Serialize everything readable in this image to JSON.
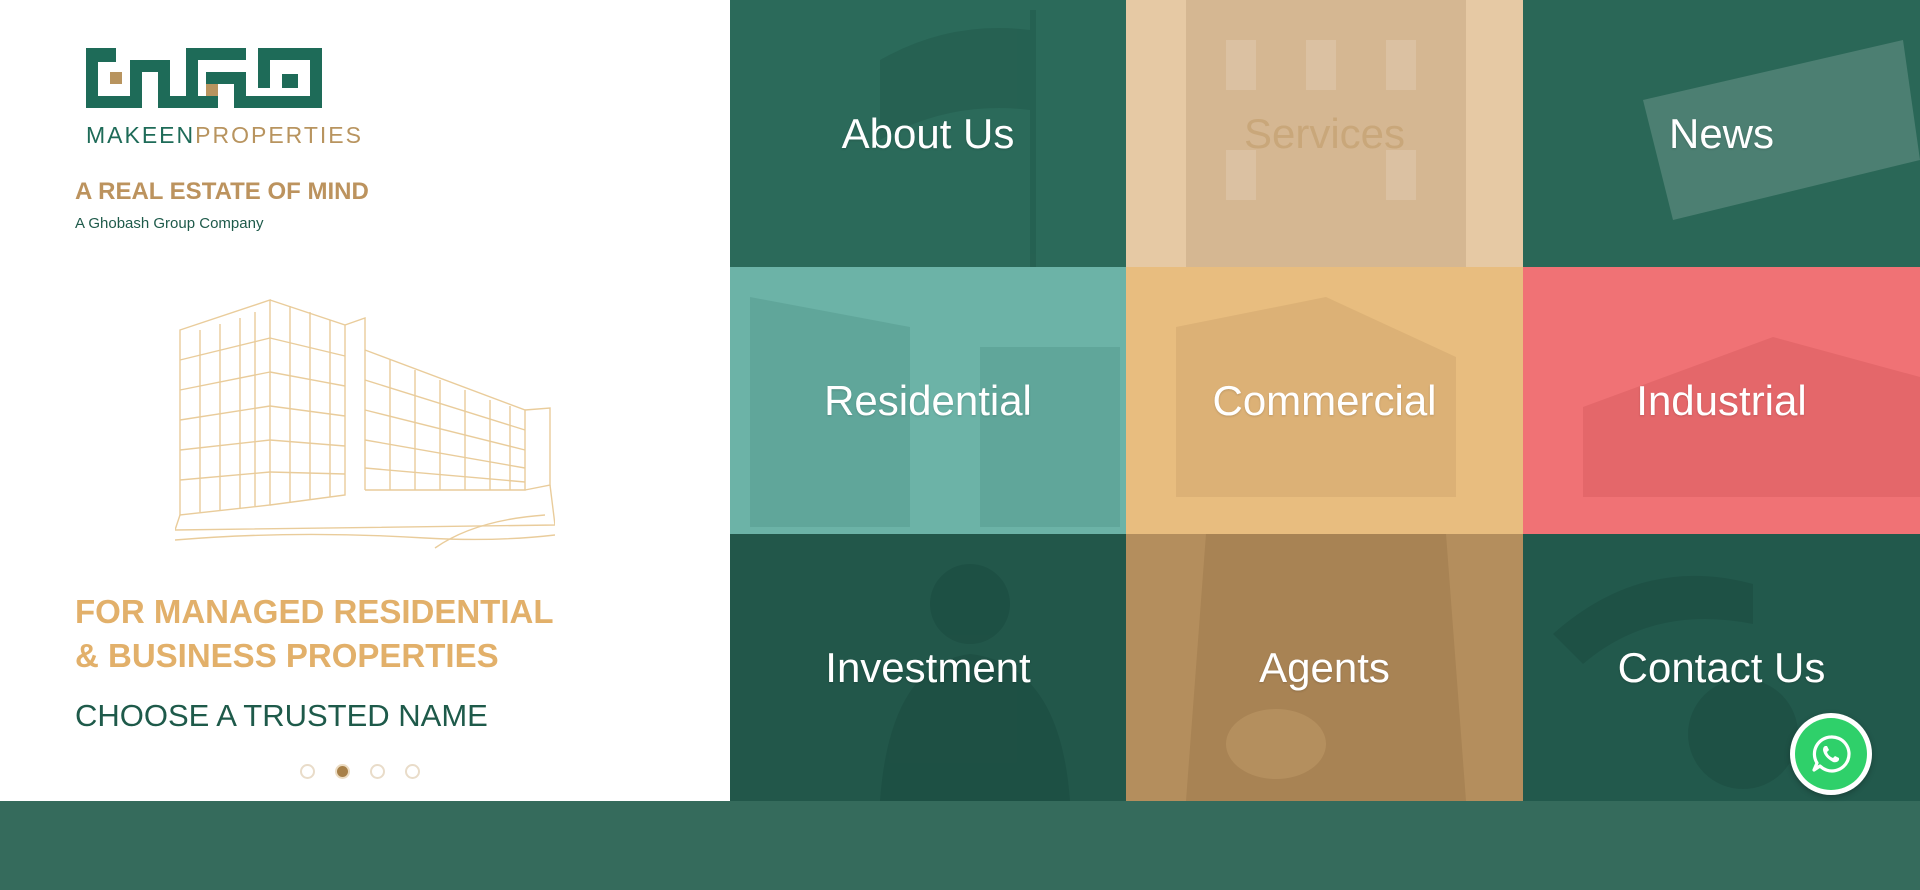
{
  "brand": {
    "logo_name_part1": "MAKEEN",
    "logo_name_part2": "PROPERTIES",
    "tagline": "A REAL ESTATE OF MIND",
    "company": "A Ghobash Group Company",
    "colors": {
      "green": "#1e6b58",
      "gold": "#b8945f"
    }
  },
  "hero": {
    "headline_line1": "FOR MANAGED RESIDENTIAL",
    "headline_line2": "& BUSINESS PROPERTIES",
    "subline": "CHOOSE A TRUSTED NAME",
    "slides": {
      "count": 4,
      "active": 2
    }
  },
  "tiles": [
    {
      "label": "About Us",
      "color": "#2b6a5a"
    },
    {
      "label": "Services",
      "color": "#e6c9a4"
    },
    {
      "label": "News",
      "color": "#2a6757"
    },
    {
      "label": "Residential",
      "color": "#6cb3a7"
    },
    {
      "label": "Commercial",
      "color": "#e8bd7f"
    },
    {
      "label": "Industrial",
      "color": "#f07275"
    },
    {
      "label": "Investment",
      "color": "#22574a"
    },
    {
      "label": "Agents",
      "color": "#b48e5d"
    },
    {
      "label": "Contact Us",
      "color": "#22594c"
    }
  ],
  "whatsapp": {
    "icon": "whatsapp-icon"
  }
}
